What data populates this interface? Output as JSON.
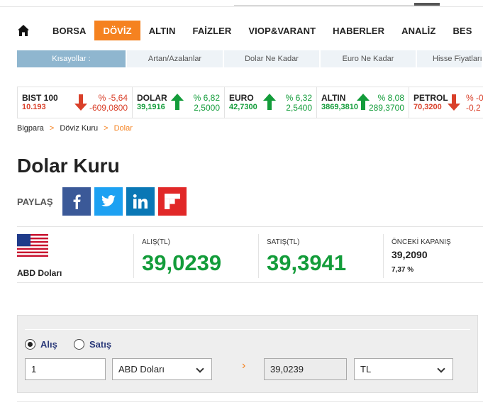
{
  "nav": {
    "items": [
      {
        "label": "BORSA",
        "active": false
      },
      {
        "label": "DÖVİZ",
        "active": true
      },
      {
        "label": "ALTIN",
        "active": false
      },
      {
        "label": "FAİZLER",
        "active": false
      },
      {
        "label": "VIOP&VARANT",
        "active": false
      },
      {
        "label": "HABERLER",
        "active": false
      },
      {
        "label": "ANALİZ",
        "active": false
      },
      {
        "label": "BES",
        "active": false
      }
    ]
  },
  "shortcuts": [
    "Kısayollar :",
    "Artan/Azalanlar",
    "Dolar Ne Kadar",
    "Euro Ne Kadar",
    "Hisse Fiyatları"
  ],
  "ticker": [
    {
      "name": "BIST 100",
      "value": "10.193",
      "direction": "down",
      "pct": "% -5,64",
      "change": "-609,0800"
    },
    {
      "name": "DOLAR",
      "value": "39,1916",
      "direction": "up",
      "pct": "% 6,82",
      "change": "2,5000"
    },
    {
      "name": "EURO",
      "value": "42,7300",
      "direction": "up",
      "pct": "% 6,32",
      "change": "2,5400"
    },
    {
      "name": "ALTIN",
      "value": "3869,3810",
      "direction": "up",
      "pct": "% 8,08",
      "change": "289,3700"
    },
    {
      "name": "PETROL",
      "value": "70,3200",
      "direction": "down",
      "pct": "% -0,",
      "change": "-0,2"
    }
  ],
  "breadcrumb": {
    "items": [
      "Bigpara",
      "Döviz Kuru",
      "Dolar"
    ],
    "separator": ">"
  },
  "page": {
    "title": "Dolar Kuru"
  },
  "share": {
    "label": "PAYLAŞ",
    "icons": [
      "facebook-icon",
      "twitter-icon",
      "linkedin-icon",
      "flipboard-icon"
    ]
  },
  "quote": {
    "currency_name": "ABD Doları",
    "buy_label": "ALIŞ(TL)",
    "buy_value": "39,0239",
    "sell_label": "SATIŞ(TL)",
    "sell_value": "39,3941",
    "prev_label": "ÖNCEKİ KAPANIŞ",
    "prev_value": "39,2090",
    "prev_pct": "7,37 %"
  },
  "converter": {
    "radio_buy": "Alış",
    "radio_sell": "Satış",
    "selected": "buy",
    "amount": "1",
    "from_currency": "ABD Doları",
    "result": "39,0239",
    "to_currency": "TL",
    "arrow": "›"
  },
  "colors": {
    "accent": "#f58220",
    "up": "#139c3a",
    "down": "#d9402a",
    "shortcut_active": "#8fb6cf"
  }
}
